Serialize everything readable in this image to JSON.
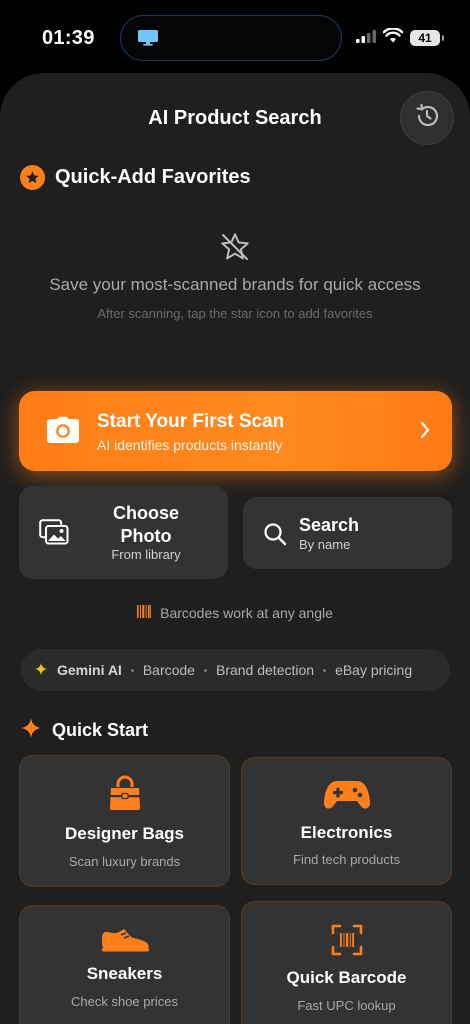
{
  "status_bar": {
    "time": "01:39",
    "battery": "41"
  },
  "header": {
    "title": "AI Product Search",
    "history_icon": "history-icon"
  },
  "favorites": {
    "title": "Quick-Add Favorites",
    "empty_main": "Save your most-scanned brands for quick access",
    "empty_sub": "After scanning, tap the star icon to add favorites"
  },
  "scan": {
    "title": "Start Your First Scan",
    "subtitle": "AI identifies products instantly"
  },
  "choose_photo": {
    "title": "Choose Photo",
    "subtitle": "From library"
  },
  "search": {
    "title": "Search",
    "subtitle": "By name"
  },
  "barcode_hint": "Barcodes work at any angle",
  "features": [
    "Gemini AI",
    "Barcode",
    "Brand detection",
    "eBay pricing"
  ],
  "quick_start": {
    "title": "Quick Start",
    "tiles": [
      {
        "name": "Designer Bags",
        "subtitle": "Scan luxury brands",
        "icon": "handbag-icon"
      },
      {
        "name": "Electronics",
        "subtitle": "Find tech products",
        "icon": "gamepad-icon"
      },
      {
        "name": "Sneakers",
        "subtitle": "Check shoe prices",
        "icon": "sneaker-icon"
      },
      {
        "name": "Quick Barcode",
        "subtitle": "Fast UPC lookup",
        "icon": "barcode-scan-icon"
      }
    ]
  },
  "colors": {
    "accent": "#ff7f1a",
    "background": "#1f1f1f",
    "card": "#333333"
  }
}
